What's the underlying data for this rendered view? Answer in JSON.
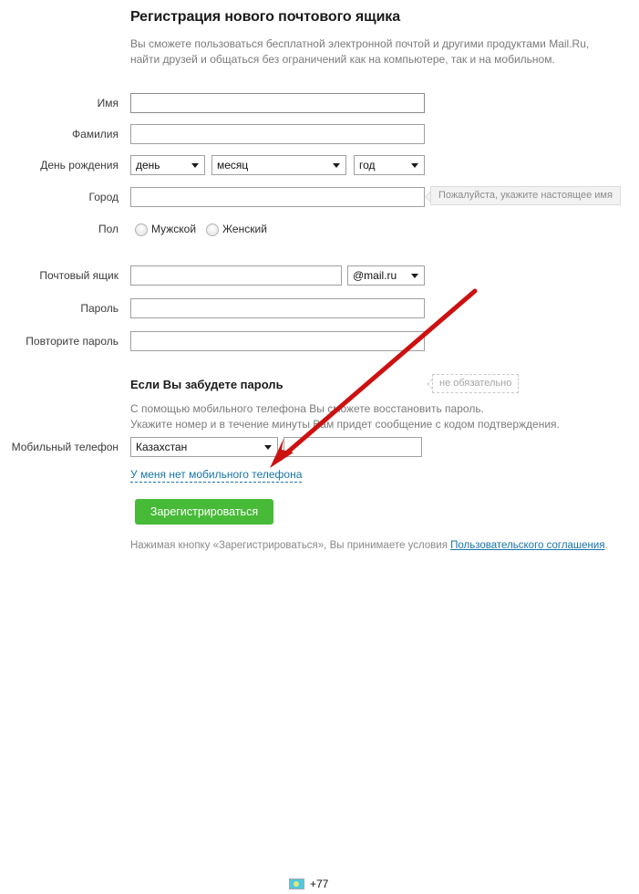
{
  "page": {
    "title": "Регистрация нового почтового ящика",
    "intro_line1": "Вы сможете пользоваться бесплатной электронной почтой и другими продуктами Mail.Ru,",
    "intro_line2": "найти друзей и общаться без ограничений как на компьютере, так и на мобильном."
  },
  "form": {
    "first_name": {
      "label": "Имя",
      "value": "",
      "placeholder": "",
      "hint": "Пожалуйста, укажите настоящее имя"
    },
    "last_name": {
      "label": "Фамилия",
      "value": "",
      "placeholder": ""
    },
    "birthday": {
      "label": "День рождения",
      "day": "день",
      "month": "месяц",
      "year": "год"
    },
    "city": {
      "label": "Город",
      "value": "",
      "placeholder": "",
      "hint": "не обязательно"
    },
    "gender": {
      "label": "Пол",
      "male": "Мужской",
      "female": "Женский",
      "selected": ""
    },
    "mailbox": {
      "label": "Почтовый ящик",
      "value": "",
      "placeholder": "",
      "domain": "@mail.ru"
    },
    "password": {
      "label": "Пароль",
      "value": ""
    },
    "password_repeat": {
      "label": "Повторите пароль",
      "value": ""
    },
    "phone": {
      "label": "Мобильный телефон",
      "country": "Казахстан",
      "flag_icon": "kz-flag-icon",
      "code": "+77",
      "number": "",
      "no_phone_link": "У меня нет мобильного телефона"
    }
  },
  "forgot": {
    "title": "Если Вы забудете пароль",
    "line1": "С помощью мобильного телефона Вы сможете восстановить пароль.",
    "line2": "Укажите номер и в течение минуты Вам придет сообщение с кодом подтверждения."
  },
  "submit": {
    "label": "Зарегистрироваться"
  },
  "footer": {
    "text_before": "Нажимая кнопку «Зарегистрироваться», Вы принимаете условия ",
    "agreement_link": "Пользовательского соглашения",
    "text_after": "."
  },
  "annotation": {
    "arrow_icon": "red-arrow-icon",
    "color": "#cc1111"
  },
  "colors": {
    "accent_green": "#47ba37",
    "link_blue": "#1874a8",
    "label_gray": "#3b3b3b",
    "muted_gray": "#7b7b7b",
    "border_gray": "#a0a0a0",
    "annotation_red": "#cc1111"
  }
}
